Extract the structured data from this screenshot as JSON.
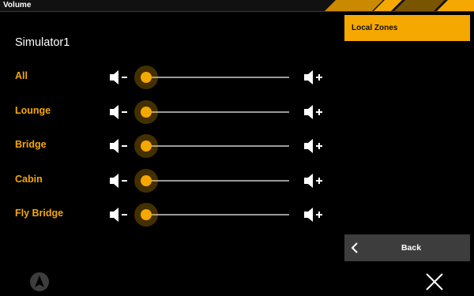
{
  "window": {
    "title": "Volume"
  },
  "device": {
    "name": "Simulator1"
  },
  "zones": [
    {
      "label": "All",
      "level": 0
    },
    {
      "label": "Lounge",
      "level": 0
    },
    {
      "label": "Bridge",
      "level": 0
    },
    {
      "label": "Cabin",
      "level": 0
    },
    {
      "label": "Fly Bridge",
      "level": 0
    }
  ],
  "side_panel": {
    "local_zones_label": "Local Zones",
    "back_label": "Back"
  },
  "icons": {
    "volume_down": "speaker-minus-icon",
    "volume_up": "speaker-plus-icon",
    "navigation": "navigation-arrow-icon",
    "close": "close-icon",
    "back": "chevron-left-icon"
  },
  "colors": {
    "accent": "#f5a800",
    "background": "#000000",
    "button": "#3d3d3d"
  }
}
